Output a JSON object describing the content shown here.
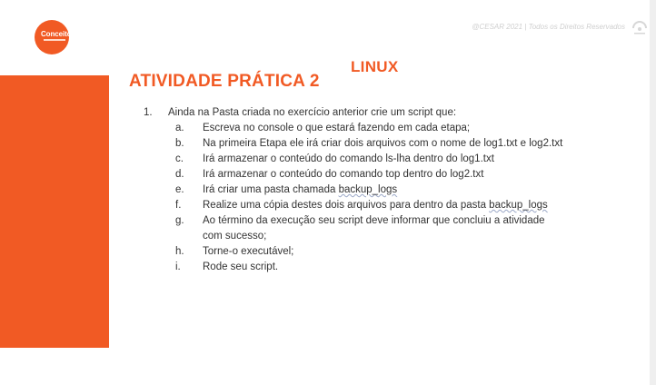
{
  "logo": {
    "text": "Conceitos"
  },
  "header": {
    "copyright": "@CESAR 2021 | Todos os Direitos Reservados"
  },
  "slide": {
    "os_title": "LINUX",
    "title": "ATIVIDADE PRÁTICA 2",
    "item_number": "1.",
    "item_text": "Ainda na Pasta criada no exercício anterior crie um script que:",
    "sub_items": [
      {
        "letter": "a.",
        "text": "Escreva no console o que estará fazendo em cada etapa;"
      },
      {
        "letter": "b.",
        "text": "Na primeira Etapa ele irá criar dois arquivos com o nome de log1.txt e log2.txt"
      },
      {
        "letter": "c.",
        "text": "Irá armazenar o conteúdo do comando ls-lha dentro do log1.txt"
      },
      {
        "letter": "d.",
        "text": "Irá armazenar o conteúdo do comando top dentro do log2.txt"
      },
      {
        "letter": "e.",
        "text_before": "Irá criar uma pasta chamada ",
        "text_link": "backup_logs"
      },
      {
        "letter": "f.",
        "text_before": "Realize uma cópia destes dois arquivos para dentro da pasta ",
        "text_link": "backup_logs"
      },
      {
        "letter": "g.",
        "text": "Ao término da execução seu script deve informar que concluiu a atividade com sucesso;"
      },
      {
        "letter": "h.",
        "text": "Torne-o executável;"
      },
      {
        "letter": "i.",
        "text": "Rode seu script."
      }
    ]
  },
  "colors": {
    "accent": "#f15a24",
    "text": "#333333"
  }
}
